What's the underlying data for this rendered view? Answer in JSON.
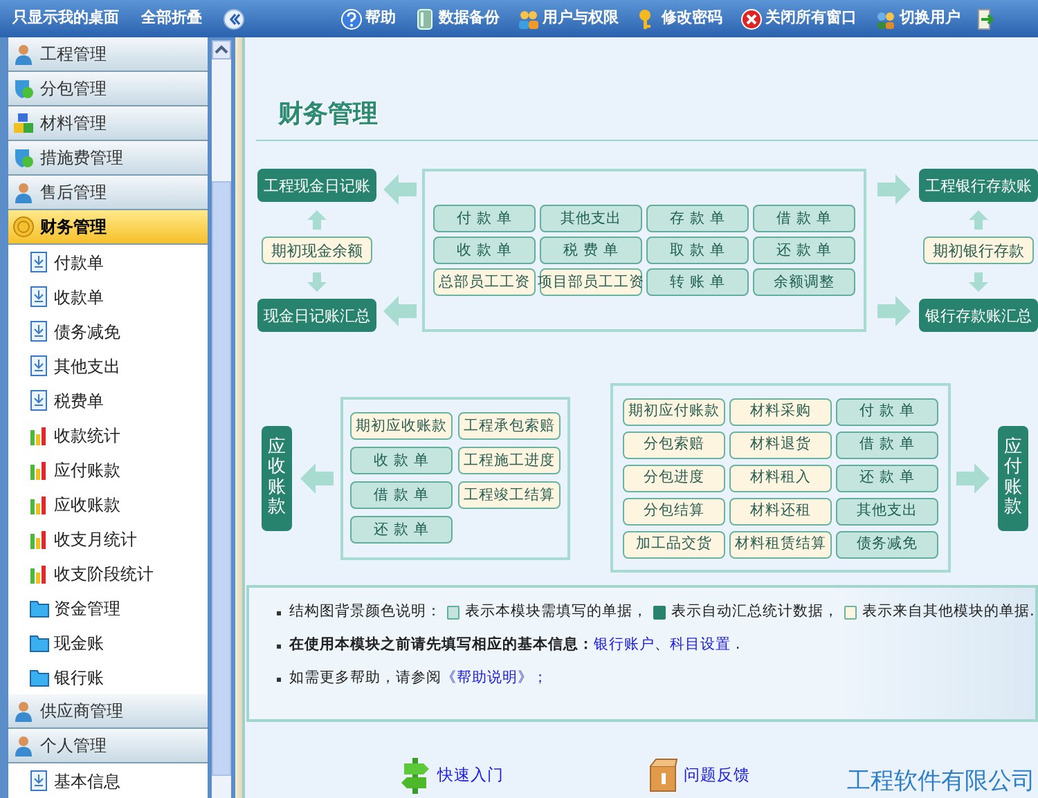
{
  "toolbar": {
    "left": [
      {
        "label": "只显示我的桌面"
      },
      {
        "label": "全部折叠"
      }
    ],
    "right": [
      {
        "label": "帮助"
      },
      {
        "label": "数据备份"
      },
      {
        "label": "用户与权限"
      },
      {
        "label": "修改密码"
      },
      {
        "label": "关闭所有窗口"
      },
      {
        "label": "切换用户"
      }
    ]
  },
  "sidebar": {
    "groups": [
      {
        "label": "工程管理",
        "selected": false
      },
      {
        "label": "分包管理",
        "selected": false
      },
      {
        "label": "材料管理",
        "selected": false
      },
      {
        "label": "措施费管理",
        "selected": false
      },
      {
        "label": "售后管理",
        "selected": false
      },
      {
        "label": "财务管理",
        "selected": true,
        "children": [
          {
            "label": "付款单",
            "kind": "document",
            "selected": false
          },
          {
            "label": "收款单",
            "kind": "document",
            "selected": false
          },
          {
            "label": "债务减免",
            "kind": "document",
            "selected": false
          },
          {
            "label": "其他支出",
            "kind": "document",
            "selected": false
          },
          {
            "label": "税费单",
            "kind": "document",
            "selected": false
          },
          {
            "label": "收款统计",
            "kind": "chart",
            "selected": false
          },
          {
            "label": "应付账款",
            "kind": "chart",
            "selected": false
          },
          {
            "label": "应收账款",
            "kind": "chart",
            "selected": false
          },
          {
            "label": "收支月统计",
            "kind": "chart",
            "selected": false
          },
          {
            "label": "收支阶段统计",
            "kind": "chart",
            "selected": false
          },
          {
            "label": "资金管理",
            "kind": "folder",
            "selected": false
          },
          {
            "label": "现金账",
            "kind": "folder",
            "selected": false
          },
          {
            "label": "银行账",
            "kind": "folder",
            "selected": false
          }
        ]
      },
      {
        "label": "供应商管理",
        "selected": false
      },
      {
        "label": "个人管理",
        "selected": false,
        "children": [
          {
            "label": "基本信息",
            "kind": "document",
            "selected": false
          }
        ]
      }
    ]
  },
  "page": {
    "title": "财务管理"
  },
  "cash_flow": {
    "left": [
      {
        "label": "工程现金日记账",
        "kind": "auto"
      },
      {
        "label": "期初现金余额",
        "kind": "external"
      },
      {
        "label": "现金日记账汇总",
        "kind": "auto"
      }
    ],
    "center": [
      {
        "label": "付 款 单",
        "kind": "fill"
      },
      {
        "label": "其他支出",
        "kind": "fill"
      },
      {
        "label": "存 款 单",
        "kind": "fill"
      },
      {
        "label": "借 款 单",
        "kind": "fill"
      },
      {
        "label": "收 款 单",
        "kind": "fill"
      },
      {
        "label": "税 费 单",
        "kind": "fill"
      },
      {
        "label": "取 款 单",
        "kind": "fill"
      },
      {
        "label": "还 款 单",
        "kind": "fill"
      },
      {
        "label": "总部员工工资",
        "kind": "external"
      },
      {
        "label": "项目部员工工资",
        "kind": "external"
      },
      {
        "label": "转 账 单",
        "kind": "fill"
      },
      {
        "label": "余额调整",
        "kind": "fill"
      }
    ],
    "right": [
      {
        "label": "工程银行存款账",
        "kind": "auto"
      },
      {
        "label": "期初银行存款",
        "kind": "external"
      },
      {
        "label": "银行存款账汇总",
        "kind": "auto"
      }
    ]
  },
  "receivables": {
    "title": "应收账款",
    "items": [
      {
        "label": "期初应收账款",
        "kind": "external"
      },
      {
        "label": "工程承包索赔",
        "kind": "external"
      },
      {
        "label": "收 款 单",
        "kind": "fill"
      },
      {
        "label": "工程施工进度",
        "kind": "external"
      },
      {
        "label": "借 款 单",
        "kind": "fill"
      },
      {
        "label": "工程竣工结算",
        "kind": "external"
      },
      {
        "label": "还 款 单",
        "kind": "fill"
      }
    ]
  },
  "payables": {
    "title": "应付账款",
    "items": [
      {
        "label": "期初应付账款",
        "kind": "external"
      },
      {
        "label": "材料采购",
        "kind": "external"
      },
      {
        "label": "付 款 单",
        "kind": "fill"
      },
      {
        "label": "分包索赔",
        "kind": "external"
      },
      {
        "label": "材料退货",
        "kind": "external"
      },
      {
        "label": "借 款 单",
        "kind": "fill"
      },
      {
        "label": "分包进度",
        "kind": "external"
      },
      {
        "label": "材料租入",
        "kind": "external"
      },
      {
        "label": "还 款 单",
        "kind": "fill"
      },
      {
        "label": "分包结算",
        "kind": "external"
      },
      {
        "label": "材料还租",
        "kind": "external"
      },
      {
        "label": "其他支出",
        "kind": "fill"
      },
      {
        "label": "加工品交货",
        "kind": "external"
      },
      {
        "label": "材料租赁结算",
        "kind": "external"
      },
      {
        "label": "债务减免",
        "kind": "fill"
      }
    ]
  },
  "notes": {
    "legend_label": "结构图背景颜色说明：",
    "legend": [
      {
        "kind": "fill",
        "text": "表示本模块需填写的单据，"
      },
      {
        "kind": "auto",
        "text": "表示自动汇总统计数据，"
      },
      {
        "kind": "external",
        "text": "表示来自其他模块的单据."
      }
    ],
    "setup_text": "在使用本模块之前请先填写相应的基本信息：",
    "setup_links": [
      "银行账户",
      "科目设置"
    ],
    "setup_separator": "、",
    "setup_end": ".",
    "help_text": "如需更多帮助，请参阅",
    "help_link": "《帮助说明》；"
  },
  "footer": {
    "links": [
      {
        "label": "快速入门"
      },
      {
        "label": "问题反馈"
      }
    ],
    "company": "工程软件有限公司"
  }
}
